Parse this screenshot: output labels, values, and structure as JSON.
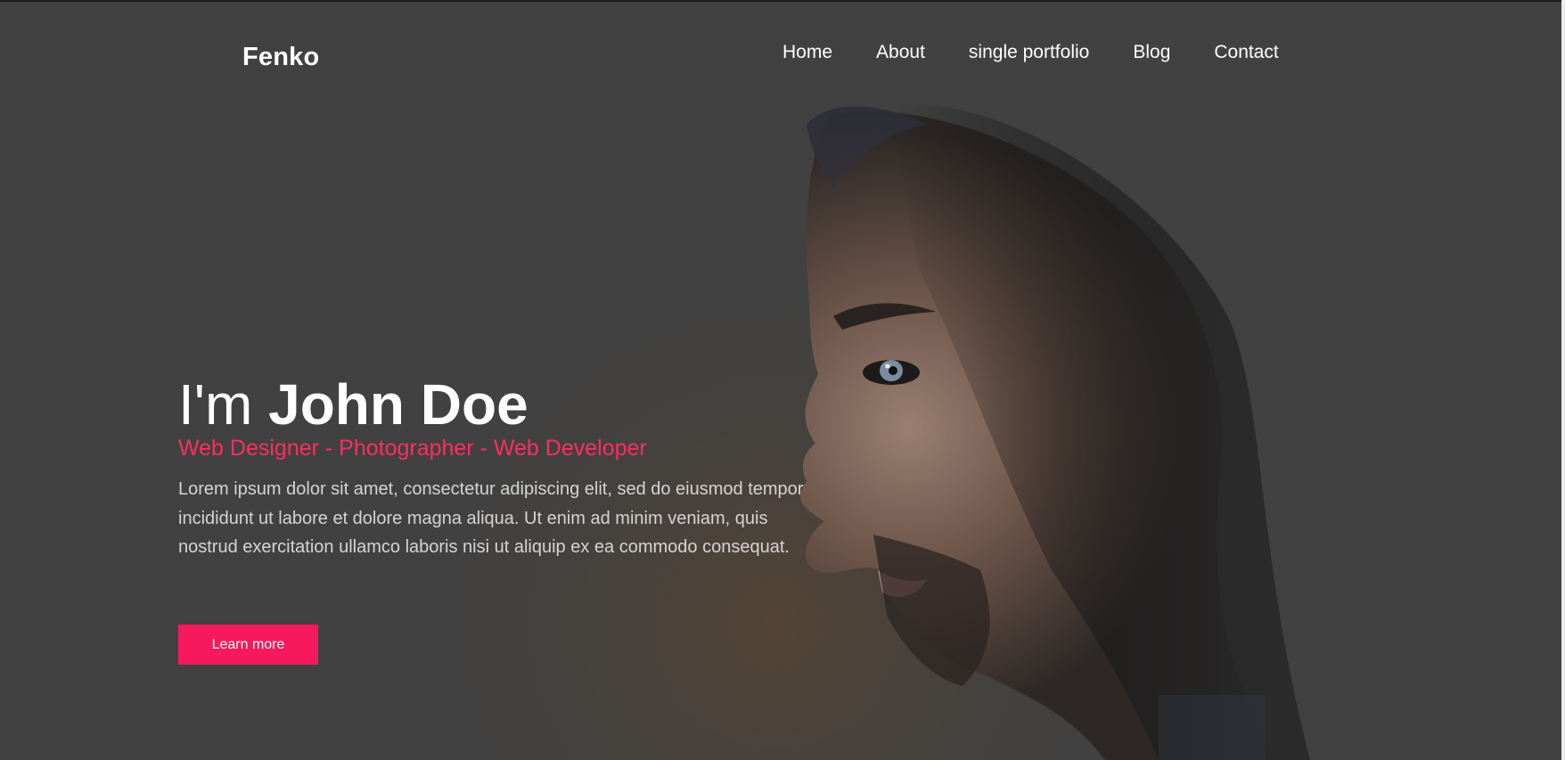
{
  "brand": {
    "logo_text": "Fenko"
  },
  "nav": {
    "items": [
      {
        "label": "Home"
      },
      {
        "label": "About"
      },
      {
        "label": "single portfolio"
      },
      {
        "label": "Blog"
      },
      {
        "label": "Contact"
      }
    ]
  },
  "hero": {
    "greeting": "I'm ",
    "name": "John Doe",
    "roles": "Web Designer - Photographer - Web Developer",
    "intro": "Lorem ipsum dolor sit amet, consectetur adipiscing elit, sed do eiusmod tempor incididunt ut labore et dolore magna aliqua. Ut enim ad minim veniam, quis nostrud exercitation ullamco laboris nisi ut aliquip ex ea commodo consequat.",
    "cta_label": "Learn more"
  },
  "colors": {
    "background": "#414141",
    "accent": "#f7195d",
    "accent_text": "#ff2d62",
    "text": "#ffffff",
    "body_text": "#d4d4d4"
  }
}
